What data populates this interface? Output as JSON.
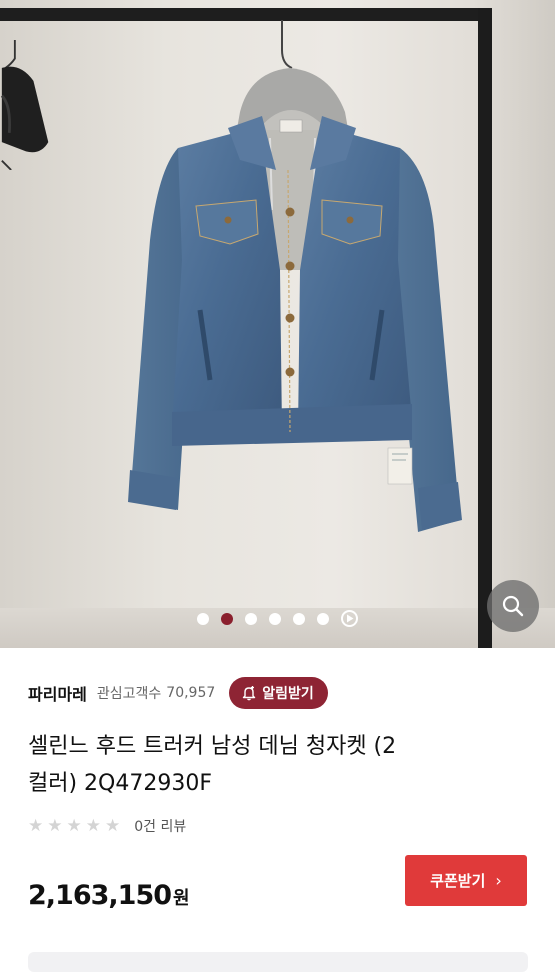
{
  "gallery": {
    "slide_count": 6,
    "active_index": 1,
    "has_video": true
  },
  "icons": {
    "zoom": "magnifier-icon",
    "play": "play-icon",
    "bell": "bell-plus-icon",
    "star": "star-icon",
    "chevron": "chevron-right-icon"
  },
  "seller": {
    "name": "파리마레",
    "watch_label": "관심고객수",
    "watch_count": "70,957",
    "alarm_label": "알림받기"
  },
  "product": {
    "title_line1": "셀린느 후드 트러커 남성 데님 청자켓 (2",
    "title_line2": "컬러) 2Q472930F",
    "rating_stars": 0,
    "review_text": "0건 리뷰",
    "price": "2,163,150",
    "currency": "원"
  },
  "coupon": {
    "label": "쿠폰받기",
    "chevron": "›"
  },
  "colors": {
    "accent_maroon": "#8e2434",
    "coupon_red": "#e03a3a",
    "active_dot": "#8a1f2d"
  }
}
